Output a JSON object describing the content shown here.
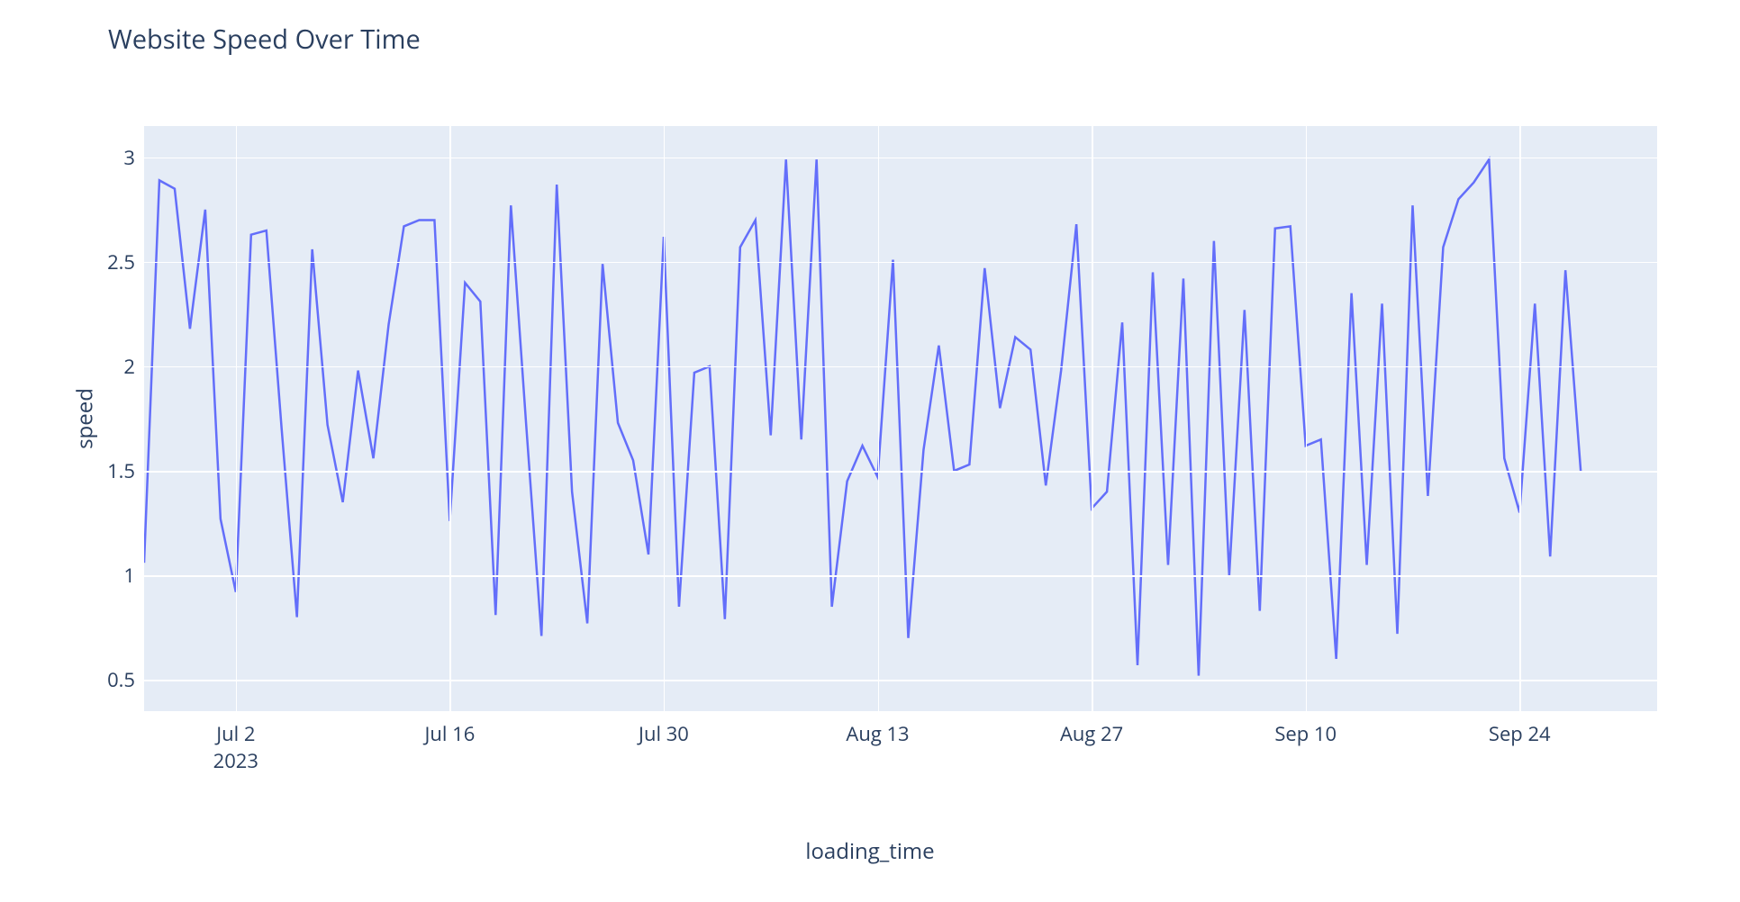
{
  "chart_data": {
    "type": "line",
    "title": "Website Speed Over Time",
    "xlabel": "loading_time",
    "ylabel": "speed",
    "ylim": [
      0.35,
      3.15
    ],
    "y_ticks": [
      0.5,
      1,
      1.5,
      2,
      2.5,
      3
    ],
    "x_ticks": [
      {
        "label": "Jul 2",
        "sub": "2023",
        "x_index": 6
      },
      {
        "label": "Jul 16",
        "sub": "",
        "x_index": 20
      },
      {
        "label": "Jul 30",
        "sub": "",
        "x_index": 34
      },
      {
        "label": "Aug 13",
        "sub": "",
        "x_index": 48
      },
      {
        "label": "Aug 27",
        "sub": "",
        "x_index": 62
      },
      {
        "label": "Sep 10",
        "sub": "",
        "x_index": 76
      },
      {
        "label": "Sep 24",
        "sub": "",
        "x_index": 90
      }
    ],
    "x_start_date": "2023-06-26",
    "n_points": 100,
    "series": [
      {
        "name": "speed",
        "values": [
          1.06,
          2.89,
          2.85,
          2.18,
          2.75,
          1.27,
          0.92,
          2.63,
          2.65,
          1.7,
          0.8,
          2.56,
          1.72,
          1.35,
          1.98,
          1.56,
          2.2,
          2.67,
          2.7,
          2.7,
          1.26,
          2.4,
          2.31,
          0.81,
          2.77,
          1.72,
          0.71,
          2.87,
          1.4,
          0.77,
          2.49,
          1.73,
          1.55,
          1.1,
          2.62,
          0.85,
          1.97,
          2.0,
          0.79,
          2.57,
          2.7,
          1.67,
          2.99,
          1.65,
          2.99,
          0.85,
          1.45,
          1.62,
          1.47,
          2.51,
          0.7,
          1.6,
          2.1,
          1.5,
          1.53,
          2.47,
          1.8,
          2.14,
          2.08,
          1.43,
          1.98,
          2.68,
          1.32,
          1.4,
          2.21,
          0.57,
          2.45,
          1.05,
          2.42,
          0.52,
          2.6,
          1.0,
          2.27,
          0.83,
          2.66,
          2.67,
          1.62,
          1.65,
          0.6,
          2.35,
          1.05,
          2.3,
          0.72,
          2.77,
          1.38,
          2.57,
          2.8,
          2.88,
          2.99,
          1.56,
          1.3,
          2.3,
          1.09,
          2.46,
          1.5
        ]
      }
    ]
  }
}
